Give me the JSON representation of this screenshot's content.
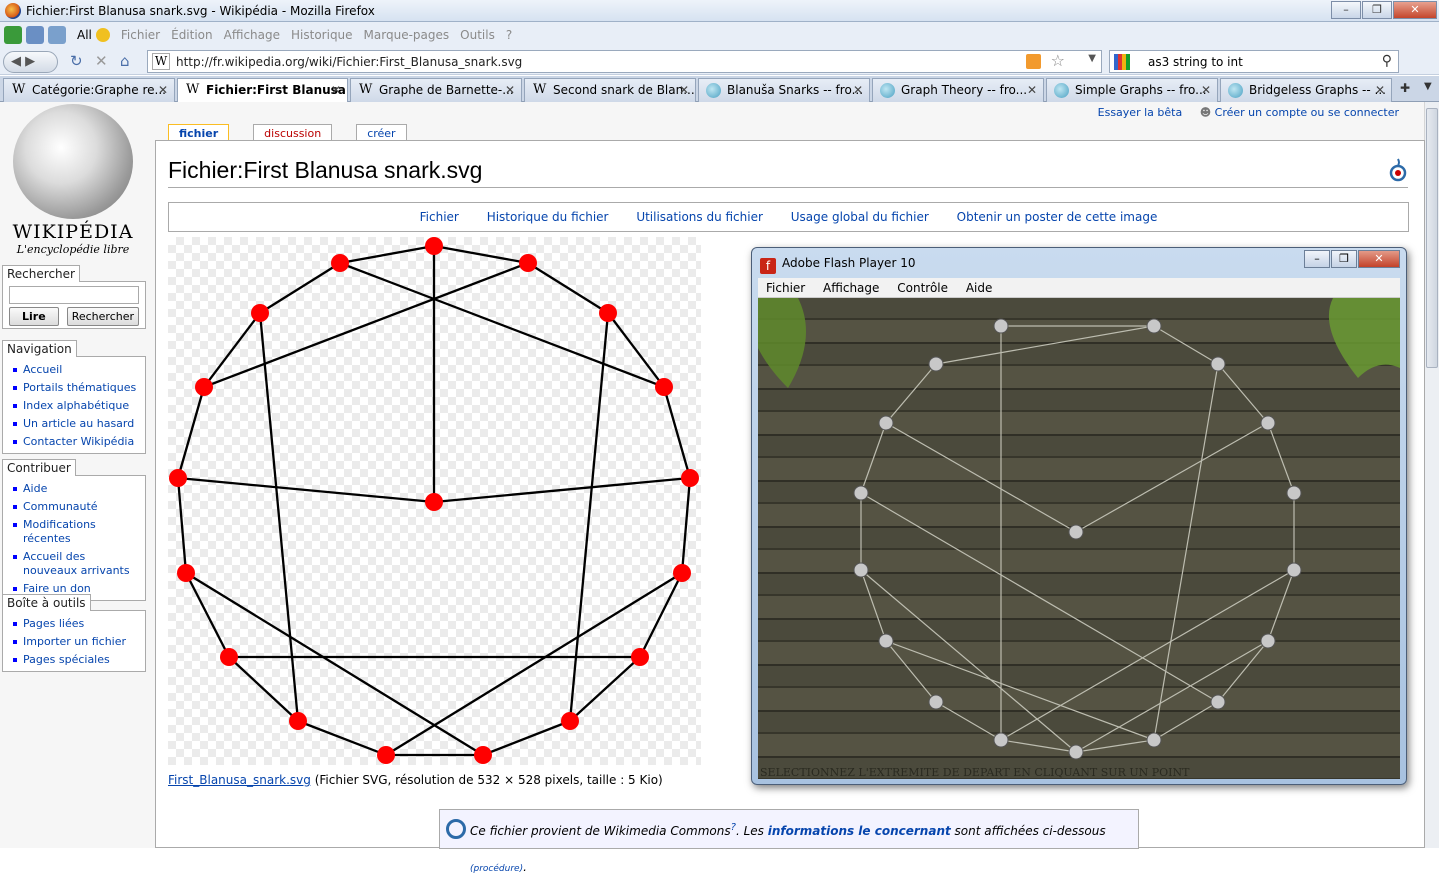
{
  "window": {
    "title": "Fichier:First Blanusa snark.svg - Wikipédia - Mozilla Firefox"
  },
  "menu": {
    "all_label": "All",
    "items": [
      "Fichier",
      "Édition",
      "Affichage",
      "Historique",
      "Marque-pages",
      "Outils",
      "?"
    ]
  },
  "nav": {
    "url": "http://fr.wikipedia.org/wiki/Fichier:First_Blanusa_snark.svg",
    "search_query": "as3 string to int"
  },
  "tabs": [
    {
      "label": "Catégorie:Graphe re...",
      "icon": "wikipedia-w-icon"
    },
    {
      "label": "Fichier:First Blanusa...",
      "icon": "wikipedia-w-icon",
      "active": true
    },
    {
      "label": "Graphe de Barnette-...",
      "icon": "wikipedia-w-icon"
    },
    {
      "label": "Second snark de Blan...",
      "icon": "wikipedia-w-icon"
    },
    {
      "label": "Blanuša Snarks -- fro...",
      "icon": "globe-icon"
    },
    {
      "label": "Graph Theory -- fro...",
      "icon": "globe-icon"
    },
    {
      "label": "Simple Graphs -- fro...",
      "icon": "globe-icon"
    },
    {
      "label": "Bridgeless Graphs -- ...",
      "icon": "globe-icon"
    }
  ],
  "logo": {
    "name": "WIKIPÉDIA",
    "tagline": "L'encyclopédie libre"
  },
  "sidebar": {
    "search": {
      "title": "Rechercher",
      "go": "Lire",
      "search": "Rechercher"
    },
    "navigation": {
      "title": "Navigation",
      "items": [
        "Accueil",
        "Portails thématiques",
        "Index alphabétique",
        "Un article au hasard",
        "Contacter Wikipédia"
      ]
    },
    "contribute": {
      "title": "Contribuer",
      "items": [
        "Aide",
        "Communauté",
        "Modifications récentes",
        "Accueil des nouveaux arrivants",
        "Faire un don"
      ]
    },
    "toolbox": {
      "title": "Boîte à outils",
      "items": [
        "Pages liées",
        "Importer un fichier",
        "Pages spéciales"
      ]
    }
  },
  "personal": {
    "beta": "Essayer la bêta",
    "login": "Créer un compte ou se connecter"
  },
  "page_tabs": [
    "fichier",
    "discussion",
    "créer"
  ],
  "page": {
    "title": "Fichier:First Blanusa snark.svg",
    "toc": [
      "Fichier",
      "Historique du fichier",
      "Utilisations du fichier",
      "Usage global du fichier",
      "Obtenir un poster de cette image"
    ],
    "caption_link": "First_Blanusa_snark.svg",
    "caption_text": " (Fichier SVG, résolution de 532 × 528 pixels, taille : 5 Kio)",
    "commons_a": "Ce fichier provient de Wikimedia Commons",
    "commons_sup": "?",
    "commons_b": ". Les ",
    "commons_link": "informations le concernant",
    "commons_c": " sont affichées ci-dessous ",
    "commons_proc": "(procédure)",
    "commons_d": "."
  },
  "flash": {
    "title": "Adobe Flash Player 10",
    "menu": [
      "Fichier",
      "Affichage",
      "Contrôle",
      "Aide"
    ],
    "status": "SELECTIONNEZ L'EXTREMITE DE DEPART EN CLIQUANT SUR UN POINT"
  },
  "colors": {
    "link": "#0645ad",
    "vertex": "#ff0000",
    "flash_icon": "#c92516"
  }
}
